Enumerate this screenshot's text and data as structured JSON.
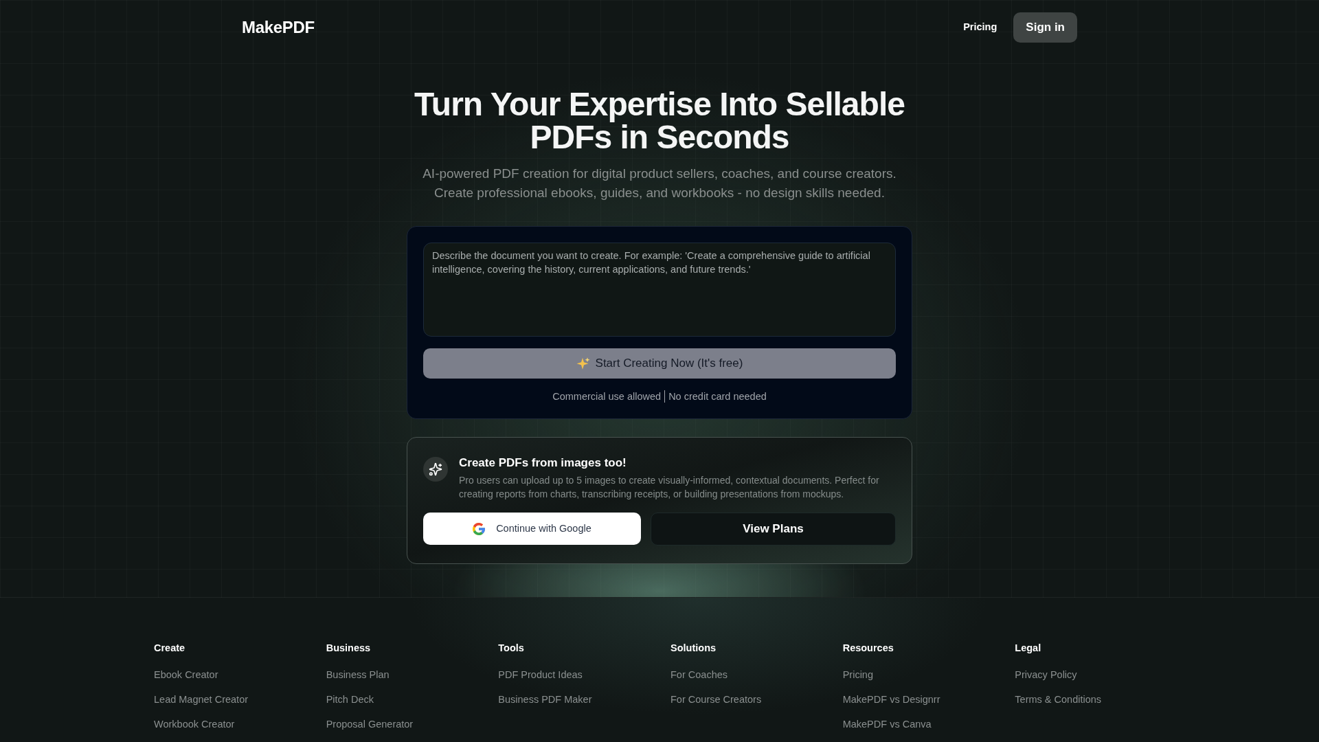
{
  "header": {
    "logo": "MakePDF",
    "links": [
      {
        "label": "Pricing",
        "kind": "link"
      },
      {
        "label": "Sign in",
        "kind": "button"
      }
    ]
  },
  "hero": {
    "title": "Turn Your Expertise Into Sellable PDFs in Seconds",
    "subtitle": "AI-powered PDF creation for digital product sellers, coaches, and course creators. Create professional ebooks, guides, and workbooks - no design skills needed."
  },
  "prompt_card": {
    "prompt": {
      "placeholder": "Describe the document you want to create. For example: 'Create a comprehensive guide to artificial intelligence, covering the history, current applications, and future trends.'"
    },
    "submit_button": "Start Creating Now (It's free)",
    "notes": [
      "Commercial use allowed",
      "No credit card needed"
    ]
  },
  "images_card": {
    "title": "Create PDFs from images too!",
    "description": "Pro users can upload up to 5 images to create visually-informed, contextual documents. Perfect for creating reports from charts, transcribing receipts, or building presentations from mockups.",
    "buttons": [
      {
        "label": "Continue with Google",
        "kind": "google"
      },
      {
        "label": "View Plans",
        "kind": "dark"
      }
    ]
  },
  "footer": {
    "columns": [
      {
        "heading": "Create",
        "links": [
          "Ebook Creator",
          "Lead Magnet Creator",
          "Workbook Creator"
        ]
      },
      {
        "heading": "Business",
        "links": [
          "Business Plan",
          "Pitch Deck",
          "Proposal Generator"
        ]
      },
      {
        "heading": "Tools",
        "links": [
          "PDF Product Ideas",
          "Business PDF Maker"
        ]
      },
      {
        "heading": "Solutions",
        "links": [
          "For Coaches",
          "For Course Creators"
        ]
      },
      {
        "heading": "Resources",
        "links": [
          "Pricing",
          "MakePDF vs Designrr",
          "MakePDF vs Canva"
        ]
      },
      {
        "heading": "Legal",
        "links": [
          "Privacy Policy",
          "Terms & Conditions"
        ]
      }
    ]
  }
}
